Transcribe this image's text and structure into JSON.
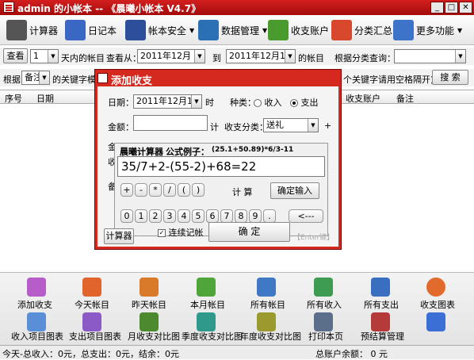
{
  "window": {
    "title": "admin 的小帐本 -- 《晨曦小帐本 V4.7》"
  },
  "toolbar": {
    "calculator": "计算器",
    "diary": "日记本",
    "account_security": "帐本安全",
    "data_management": "数据管理",
    "income_expense_account": "收支账户",
    "category_summary": "分类汇总",
    "more_features": "更多功能"
  },
  "filter": {
    "view_button": "查看",
    "days_value": "1",
    "days_suffix": "天内的帐目",
    "view_from_label": "查看从：",
    "from_date": "2011年12月 1日",
    "to_label": "到",
    "to_date": "2011年12月13日",
    "accounts_suffix": "的帐目",
    "category_query_label": "根据分类查询：",
    "category_value": "",
    "by_label": "根据",
    "field_value": "备注",
    "keyword_label": "的关键字模",
    "keyword_hint": "个关键字请用空格隔开)",
    "search_button": "搜 索"
  },
  "table": {
    "headers": [
      "序号",
      "日期",
      "收支账户",
      "备注"
    ]
  },
  "dialog": {
    "title": "添加收支",
    "date_label": "日期：",
    "date_value": "2011年12月13日",
    "time_label": "时",
    "type_label": "种类：",
    "income_label": "收入",
    "expense_label": "支出",
    "amount_label": "金额：",
    "calc_label": "计",
    "category_label": "收支分类：",
    "category_value": "送礼",
    "plus_mark": "+",
    "left_label_1": "金",
    "left_label_2": "收",
    "left_label_3": "备",
    "continuous_label": "连续记帐",
    "calculator_button": "计算器",
    "confirm_button": "确 定",
    "enter_hint": "【Enter键】"
  },
  "calculator": {
    "title": "晨曦计算器",
    "example_label": "公式例子：",
    "example_formula": "(25.1+50.89)*6/3-11",
    "expression": "35/7+2-(55-2)+68=22",
    "operators": [
      "+",
      "-",
      "*",
      "/",
      "(",
      ")"
    ],
    "digits": [
      "0",
      "1",
      "2",
      "3",
      "4",
      "5",
      "6",
      "7",
      "8",
      "9",
      "."
    ],
    "backspace": "<---",
    "compute_label": "计 算",
    "confirm_input": "确定输入"
  },
  "bottom": {
    "row1": [
      "添加收支",
      "今天帐目",
      "昨天帐目",
      "本月帐目",
      "所有帐目",
      "所有收入",
      "所有支出",
      "收支图表"
    ],
    "row2": [
      "收入项目图表",
      "支出项目图表",
      "月收支对比图",
      "季度收支对比图",
      "年度收支对比图",
      "打印本页",
      "预结算管理"
    ]
  },
  "status": {
    "summary": "今天-总收入：0元，总支出：0元，结余：0元",
    "balance": "总账户余额： 0 元"
  }
}
